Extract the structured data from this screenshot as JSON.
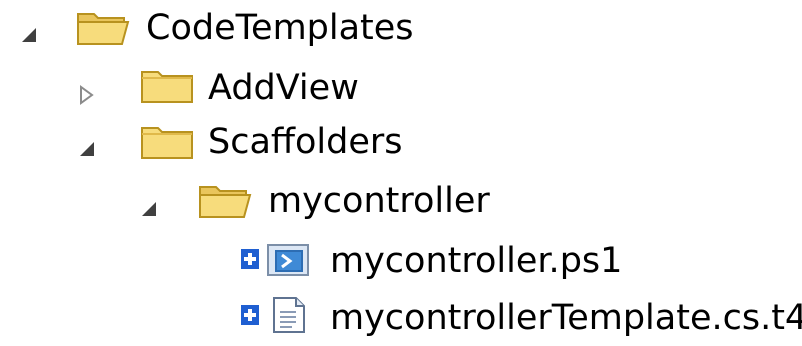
{
  "tree": {
    "nodes": [
      {
        "label": "CodeTemplates",
        "icon": "folder-open-icon",
        "expander": "expanded"
      },
      {
        "label": "AddView",
        "icon": "folder-closed-icon",
        "expander": "collapsed"
      },
      {
        "label": "Scaffolders",
        "icon": "folder-closed-icon",
        "expander": "expanded"
      },
      {
        "label": "mycontroller",
        "icon": "folder-open-icon",
        "expander": "expanded"
      },
      {
        "label": "mycontroller.ps1",
        "icon": "powershell-file-icon",
        "expander": "none",
        "status": "source-control-add-icon"
      },
      {
        "label": "mycontrollerTemplate.cs.t4",
        "icon": "text-file-icon",
        "expander": "none",
        "status": "source-control-add-icon"
      }
    ]
  },
  "colors": {
    "folder_fill": "#f7dc7c",
    "folder_stroke": "#c9a227",
    "expander_fill": "#404040",
    "add_badge": "#1f5fd1"
  }
}
